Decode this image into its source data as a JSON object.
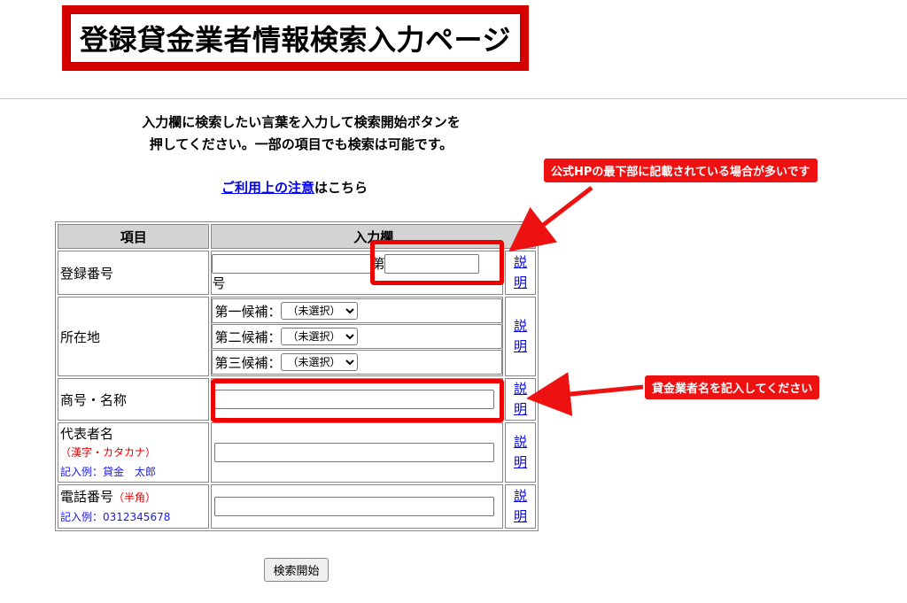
{
  "page_title": "登録貸金業者情報検索入力ページ",
  "intro_lines": [
    "入力欄に検索したい言葉を入力して検索開始ボタンを",
    "押してください。一部の項目でも検索は可能です。"
  ],
  "notice": {
    "link_text": "ご利用上の注意",
    "suffix": "はこちら"
  },
  "table": {
    "headers": {
      "item": "項目",
      "input": "入力欄"
    },
    "help_link": "説明",
    "registration": {
      "label": "登録番号",
      "prefix_value": "",
      "dai": "第",
      "number_value": "",
      "go": "号"
    },
    "location": {
      "label": "所在地",
      "candidates": [
        {
          "label": "第一候補：",
          "selected": "（未選択）"
        },
        {
          "label": "第二候補：",
          "selected": "（未選択）"
        },
        {
          "label": "第三候補：",
          "selected": "（未選択）"
        }
      ]
    },
    "trade_name": {
      "label": "商号・名称",
      "value": ""
    },
    "representative": {
      "label": "代表者名",
      "note": "（漢字・カタカナ）",
      "example": "記入例：貸金　太郎",
      "value": ""
    },
    "phone": {
      "label": "電話番号",
      "note": "（半角）",
      "example": "記入例：0312345678",
      "value": ""
    }
  },
  "submit_label": "検索開始",
  "annotations": {
    "callout_top": "公式HPの最下部に記載されている場合が多いです",
    "callout_mid": "貸金業者名を記入してください",
    "color": "#ee1111"
  }
}
